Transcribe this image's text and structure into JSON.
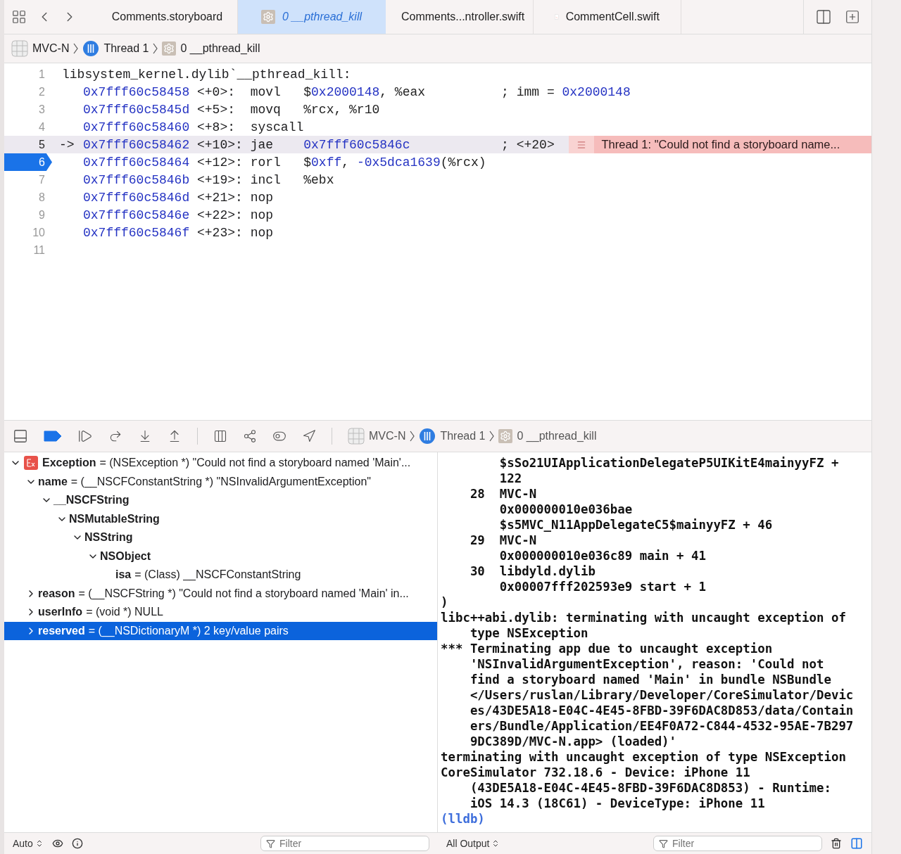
{
  "tabs": [
    {
      "label": "Comments.storyboard",
      "kind": "storyboard",
      "selected": false
    },
    {
      "label": "0 __pthread_kill",
      "kind": "frame",
      "selected": true
    },
    {
      "label": "Comments...ntroller.swift",
      "kind": "swift",
      "selected": false
    },
    {
      "label": "CommentCell.swift",
      "kind": "swift",
      "selected": false
    }
  ],
  "breadcrumb": [
    {
      "label": "MVC-N",
      "kind": "app"
    },
    {
      "label": "Thread 1",
      "kind": "thread"
    },
    {
      "label": "0 __pthread_kill",
      "kind": "frame"
    }
  ],
  "disassembly": {
    "lines": [
      {
        "number": "1",
        "kind": "label",
        "text": "libsystem_kernel.dylib`__pthread_kill:",
        "current": false,
        "pc": false
      },
      {
        "number": "2",
        "kind": "instruction",
        "address": "0x7fff60c58458",
        "offset": "<+0>:",
        "mnemonic": "movl",
        "operands": [
          {
            "text": "$",
            "kind": "plain"
          },
          {
            "text": "0x2000148",
            "kind": "number"
          },
          {
            "text": ", %eax",
            "kind": "plain"
          }
        ],
        "comment": [
          {
            "text": "; imm = ",
            "kind": "plain"
          },
          {
            "text": "0x2000148",
            "kind": "number"
          }
        ],
        "current": false,
        "pc": false
      },
      {
        "number": "3",
        "kind": "instruction",
        "address": "0x7fff60c5845d",
        "offset": "<+5>:",
        "mnemonic": "movq",
        "operands": [
          {
            "text": "%rcx, %r10",
            "kind": "plain"
          }
        ],
        "current": false,
        "pc": false
      },
      {
        "number": "4",
        "kind": "instruction",
        "address": "0x7fff60c58460",
        "offset": "<+8>:",
        "mnemonic": "syscall",
        "current": false,
        "pc": false
      },
      {
        "number": "5",
        "kind": "instruction",
        "marker": "->",
        "address": "0x7fff60c58462",
        "offset": "<+10>:",
        "mnemonic": "jae",
        "operands": [
          {
            "text": "0x7fff60c5846c",
            "kind": "number"
          }
        ],
        "comment": [
          {
            "text": "; <+20>",
            "kind": "plain"
          }
        ],
        "annotation": "Thread 1: \"Could not find a storyboard name...",
        "current": true,
        "pc": false
      },
      {
        "number": "6",
        "kind": "instruction",
        "address": "0x7fff60c58464",
        "offset": "<+12>:",
        "mnemonic": "rorl",
        "operands": [
          {
            "text": "$",
            "kind": "plain"
          },
          {
            "text": "0xff",
            "kind": "number"
          },
          {
            "text": ", ",
            "kind": "plain"
          },
          {
            "text": "-0x5dca1639",
            "kind": "number"
          },
          {
            "text": "(%rcx)",
            "kind": "plain"
          }
        ],
        "current": false,
        "pc": true
      },
      {
        "number": "7",
        "kind": "instruction",
        "address": "0x7fff60c5846b",
        "offset": "<+19>:",
        "mnemonic": "incl",
        "operands": [
          {
            "text": "%ebx",
            "kind": "plain"
          }
        ],
        "current": false,
        "pc": false
      },
      {
        "number": "8",
        "kind": "instruction",
        "address": "0x7fff60c5846d",
        "offset": "<+21>:",
        "mnemonic": "nop",
        "current": false,
        "pc": false
      },
      {
        "number": "9",
        "kind": "instruction",
        "address": "0x7fff60c5846e",
        "offset": "<+22>:",
        "mnemonic": "nop",
        "current": false,
        "pc": false
      },
      {
        "number": "10",
        "kind": "instruction",
        "address": "0x7fff60c5846f",
        "offset": "<+23>:",
        "mnemonic": "nop",
        "current": false,
        "pc": false
      },
      {
        "number": "11",
        "kind": "empty",
        "current": false,
        "pc": false
      }
    ]
  },
  "debug_bar": {
    "breakpoints_active": true,
    "breadcrumb": [
      {
        "label": "MVC-N",
        "kind": "app"
      },
      {
        "label": "Thread 1",
        "kind": "thread"
      },
      {
        "label": "0 __pthread_kill",
        "kind": "frame"
      }
    ]
  },
  "variables": [
    {
      "name": "Exception",
      "detail": "= (NSException *) \"Could not find a storyboard named 'Main'...",
      "kind": "exception",
      "expanded": true,
      "selected": false,
      "children": [
        {
          "name": "name",
          "detail": "= (__NSCFConstantString *) \"NSInvalidArgumentException\"",
          "expanded": true,
          "selected": false,
          "children": [
            {
              "name": "__NSCFString",
              "expanded": true,
              "selected": false,
              "children": [
                {
                  "name": "NSMutableString",
                  "expanded": true,
                  "selected": false,
                  "children": [
                    {
                      "name": "NSString",
                      "expanded": true,
                      "selected": false,
                      "children": [
                        {
                          "name": "NSObject",
                          "expanded": true,
                          "selected": false,
                          "children": [
                            {
                              "name": "isa",
                              "detail": "= (Class) __NSCFConstantString",
                              "selected": false
                            }
                          ]
                        }
                      ]
                    }
                  ]
                }
              ]
            }
          ]
        },
        {
          "name": "reason",
          "detail": "= (__NSCFString *) \"Could not find a storyboard named 'Main' in...",
          "expanded": false,
          "selected": false
        },
        {
          "name": "userInfo",
          "detail": "= (void *) NULL",
          "expanded": false,
          "selected": false
        },
        {
          "name": "reserved",
          "detail": "= (__NSDictionaryM *) 2 key/value pairs",
          "expanded": false,
          "selected": true
        }
      ]
    }
  ],
  "console": [
    {
      "kind": "frame-wrap",
      "text": "$sSo21UIApplicationDelegateP5UIKitE4mainyyFZ +"
    },
    {
      "kind": "frame-wrap",
      "text": "122"
    },
    {
      "kind": "frame",
      "number": "28",
      "text": "MVC-N"
    },
    {
      "kind": "frame-wrap",
      "text": "0x000000010e036bae"
    },
    {
      "kind": "frame-wrap",
      "text": "$s5MVC_N11AppDelegateC5$mainyyFZ + 46"
    },
    {
      "kind": "frame",
      "number": "29",
      "text": "MVC-N"
    },
    {
      "kind": "frame-wrap",
      "text": "0x000000010e036c89 main + 41"
    },
    {
      "kind": "frame",
      "number": "30",
      "text": "libdyld.dylib"
    },
    {
      "kind": "frame-wrap",
      "text": "0x00007fff202593e9 start + 1"
    },
    {
      "kind": "top",
      "text": ")"
    },
    {
      "kind": "top",
      "text": "libc++abi.dylib: terminating with uncaught exception of"
    },
    {
      "kind": "wrap",
      "text": "type NSException"
    },
    {
      "kind": "top",
      "text": "*** Terminating app due to uncaught exception"
    },
    {
      "kind": "wrap",
      "text": "'NSInvalidArgumentException', reason: 'Could not"
    },
    {
      "kind": "wrap",
      "text": "find a storyboard named 'Main' in bundle NSBundle"
    },
    {
      "kind": "wrap",
      "text": "</Users/ruslan/Library/Developer/CoreSimulator/Devic"
    },
    {
      "kind": "wrap",
      "text": "es/43DE5A18-E04C-4E45-8FBD-39F6DAC8D853/data/Contain"
    },
    {
      "kind": "wrap",
      "text": "ers/Bundle/Application/EE4F0A72-C844-4532-95AE-7B297"
    },
    {
      "kind": "wrap",
      "text": "9DC389D/MVC-N.app> (loaded)'"
    },
    {
      "kind": "top",
      "text": "terminating with uncaught exception of type NSException"
    },
    {
      "kind": "top",
      "text": "CoreSimulator 732.18.6 - Device: iPhone 11"
    },
    {
      "kind": "wrap",
      "text": "(43DE5A18-E04C-4E45-8FBD-39F6DAC8D853) - Runtime:"
    },
    {
      "kind": "wrap",
      "text": "iOS 14.3 (18C61) - DeviceType: iPhone 11"
    },
    {
      "kind": "prompt",
      "text": "(lldb)"
    }
  ],
  "variables_footer": {
    "scope": "Auto",
    "filter_placeholder": "Filter"
  },
  "console_footer": {
    "output": "All Output",
    "filter_placeholder": "Filter"
  }
}
